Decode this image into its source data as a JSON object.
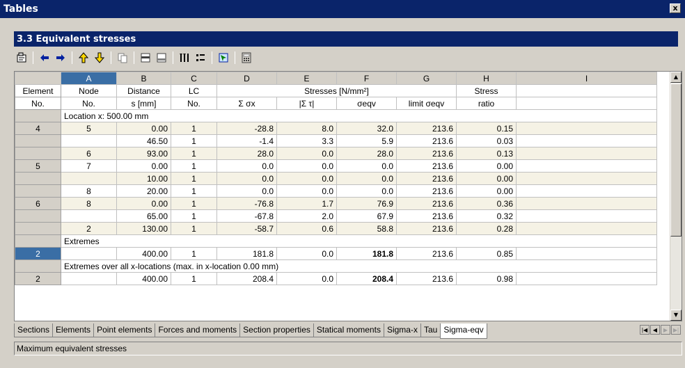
{
  "window": {
    "title": "Tables",
    "close_label": "x"
  },
  "panel": {
    "title": "3.3 Equivalent stresses"
  },
  "toolbar": {
    "icons": [
      "properties-icon",
      "arrow-left-icon",
      "arrow-right-icon",
      "filter-up-icon",
      "filter-down-icon",
      "copy-icon",
      "table-insert-icon",
      "table-delete-icon",
      "columns-icon",
      "list-icon",
      "select-icon",
      "calculator-icon"
    ]
  },
  "columns": {
    "letters": [
      "A",
      "B",
      "C",
      "D",
      "E",
      "F",
      "G",
      "H",
      "I"
    ],
    "header1": {
      "element": "Element",
      "node": "Node",
      "distance": "Distance",
      "lc": "LC",
      "stresses": "Stresses [N/mm²]",
      "stress": "Stress"
    },
    "header2": {
      "element": "No.",
      "node": "No.",
      "distance": "s [mm]",
      "lc": "No.",
      "sum_sx": "Σ σx",
      "sum_tau": "|Σ τ|",
      "seqv": "σeqv",
      "limit": "limit σeqv",
      "ratio": "ratio"
    }
  },
  "sections": {
    "location": "Location x: 500.00 mm",
    "extremes": "Extremes",
    "extremes_all": "Extremes over all x-locations (max. in x-location 0.00 mm)"
  },
  "rows": [
    {
      "element": "4",
      "node": "5",
      "s": "0.00",
      "lc": "1",
      "sx": "-28.8",
      "tau": "8.0",
      "seqv": "32.0",
      "limit": "213.6",
      "ratio": "0.15"
    },
    {
      "element": "",
      "node": "",
      "s": "46.50",
      "lc": "1",
      "sx": "-1.4",
      "tau": "3.3",
      "seqv": "5.9",
      "limit": "213.6",
      "ratio": "0.03"
    },
    {
      "element": "",
      "node": "6",
      "s": "93.00",
      "lc": "1",
      "sx": "28.0",
      "tau": "0.0",
      "seqv": "28.0",
      "limit": "213.6",
      "ratio": "0.13"
    },
    {
      "element": "5",
      "node": "7",
      "s": "0.00",
      "lc": "1",
      "sx": "0.0",
      "tau": "0.0",
      "seqv": "0.0",
      "limit": "213.6",
      "ratio": "0.00"
    },
    {
      "element": "",
      "node": "",
      "s": "10.00",
      "lc": "1",
      "sx": "0.0",
      "tau": "0.0",
      "seqv": "0.0",
      "limit": "213.6",
      "ratio": "0.00"
    },
    {
      "element": "",
      "node": "8",
      "s": "20.00",
      "lc": "1",
      "sx": "0.0",
      "tau": "0.0",
      "seqv": "0.0",
      "limit": "213.6",
      "ratio": "0.00"
    },
    {
      "element": "6",
      "node": "8",
      "s": "0.00",
      "lc": "1",
      "sx": "-76.8",
      "tau": "1.7",
      "seqv": "76.9",
      "limit": "213.6",
      "ratio": "0.36"
    },
    {
      "element": "",
      "node": "",
      "s": "65.00",
      "lc": "1",
      "sx": "-67.8",
      "tau": "2.0",
      "seqv": "67.9",
      "limit": "213.6",
      "ratio": "0.32"
    },
    {
      "element": "",
      "node": "2",
      "s": "130.00",
      "lc": "1",
      "sx": "-58.7",
      "tau": "0.6",
      "seqv": "58.8",
      "limit": "213.6",
      "ratio": "0.28"
    }
  ],
  "extreme_row": {
    "element": "2",
    "node": "",
    "s": "400.00",
    "lc": "1",
    "sx": "181.8",
    "tau": "0.0",
    "seqv": "181.8",
    "limit": "213.6",
    "ratio": "0.85"
  },
  "extreme_all_row": {
    "element": "2",
    "node": "",
    "s": "400.00",
    "lc": "1",
    "sx": "208.4",
    "tau": "0.0",
    "seqv": "208.4",
    "limit": "213.6",
    "ratio": "0.98"
  },
  "tabs": [
    "Sections",
    "Elements",
    "Point elements",
    "Forces and moments",
    "Section properties",
    "Statical moments",
    "Sigma-x",
    "Tau",
    "Sigma-eqv"
  ],
  "active_tab": "Sigma-eqv",
  "status": "Maximum equivalent stresses"
}
